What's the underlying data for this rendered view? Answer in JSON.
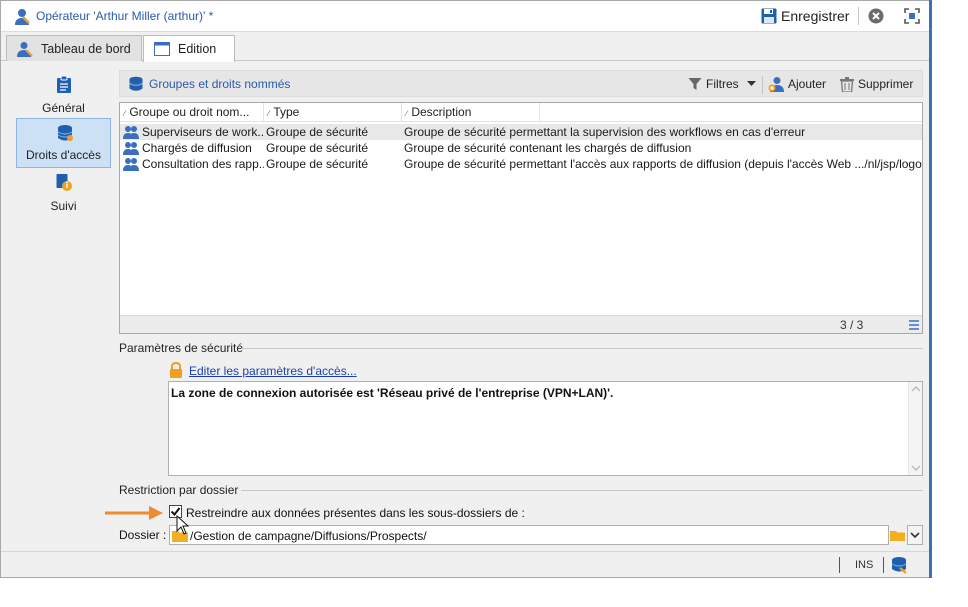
{
  "window": {
    "title": "Opérateur 'Arthur Miller (arthur)' *",
    "save_label": "Enregistrer"
  },
  "tabs": [
    {
      "label": "Tableau de bord"
    },
    {
      "label": "Edition"
    }
  ],
  "sidebar": {
    "items": [
      {
        "label": "Général"
      },
      {
        "label": "Droits d'accès"
      },
      {
        "label": "Suivi"
      }
    ]
  },
  "toolbar": {
    "title": "Groupes et droits nommés",
    "filters_label": "Filtres",
    "add_label": "Ajouter",
    "delete_label": "Supprimer"
  },
  "list": {
    "columns": [
      "Groupe ou droit nom...",
      "Type",
      "Description"
    ],
    "rows": [
      {
        "name": "Superviseurs de work...",
        "type": "Groupe de sécurité",
        "description": "Groupe de sécurité permettant la supervision des workflows en cas d'erreur"
      },
      {
        "name": "Chargés de diffusion",
        "type": "Groupe de sécurité",
        "description": "Groupe de sécurité contenant les chargés de diffusion"
      },
      {
        "name": "Consultation des rapp...",
        "type": "Groupe de sécurité",
        "description": "Groupe de sécurité permettant l'accès aux rapports de diffusion (depuis l'accès Web .../nl/jsp/logon"
      }
    ],
    "count": "3 / 3"
  },
  "security": {
    "section_title": "Paramètres de sécurité",
    "edit_link": "Editer les paramètres d'accès...",
    "text": "La zone de connexion autorisée est 'Réseau privé de l'entreprise (VPN+LAN)'."
  },
  "restriction": {
    "section_title": "Restriction par dossier",
    "checkbox_label": "Restreindre aux données présentes dans les sous-dossiers de :",
    "checked": true,
    "folder_label": "Dossier :",
    "folder_value": "/Gestion de campagne/Diffusions/Prospects/"
  },
  "statusbar": {
    "ins": "INS"
  },
  "colors": {
    "accent": "#2a5aa8",
    "selection": "#cce0f6",
    "arrow": "#f08a30",
    "link": "#1a3fb4"
  }
}
